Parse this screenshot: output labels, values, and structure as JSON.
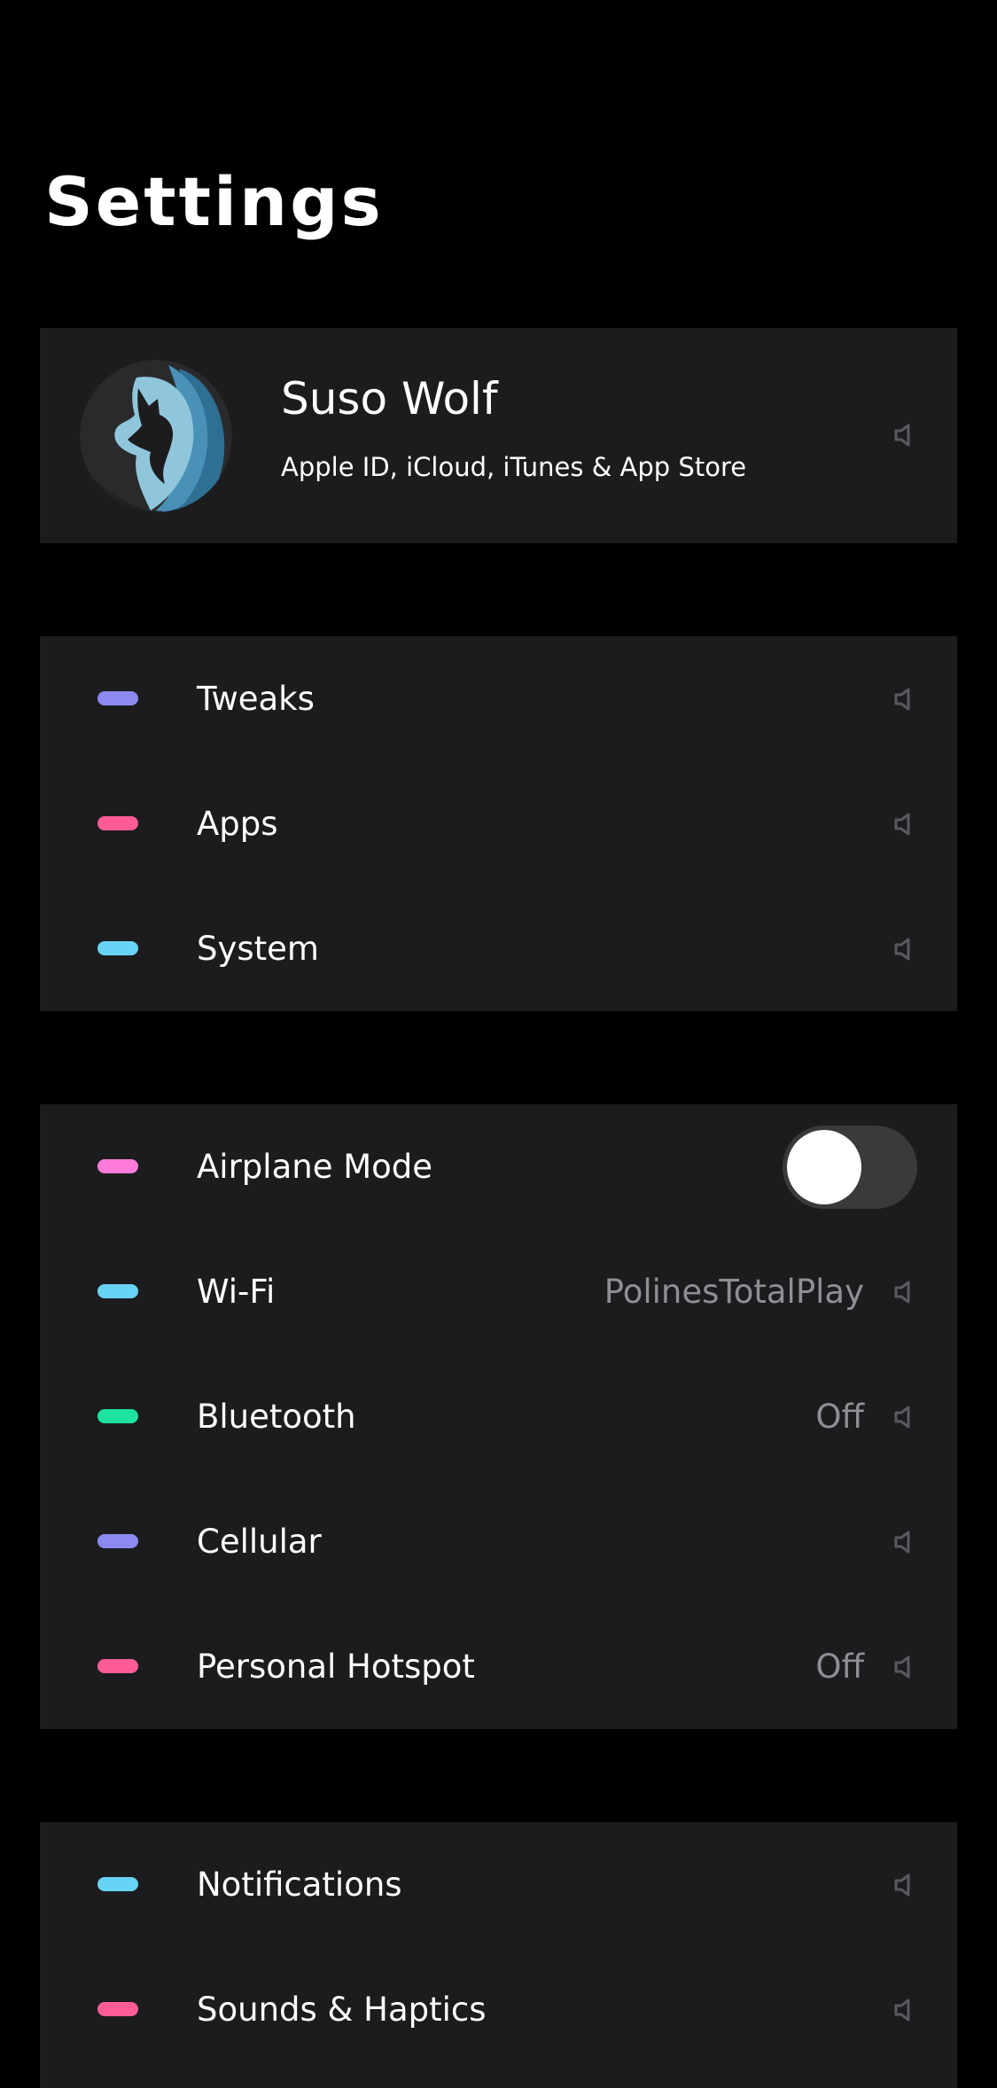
{
  "header": {
    "title": "Settings"
  },
  "profile": {
    "name": "Suso Wolf",
    "subtitle": "Apple ID, iCloud, iTunes & App Store"
  },
  "group1": [
    {
      "label": "Tweaks",
      "color": "#8b8af0"
    },
    {
      "label": "Apps",
      "color": "#ff5c97"
    },
    {
      "label": "System",
      "color": "#67d3f5"
    }
  ],
  "group2": [
    {
      "label": "Airplane Mode",
      "color": "#ff7ad9",
      "toggle": false
    },
    {
      "label": "Wi-Fi",
      "color": "#67d3f5",
      "value": "PolinesTotalPlay"
    },
    {
      "label": "Bluetooth",
      "color": "#1ee3a0",
      "value": "Off"
    },
    {
      "label": "Cellular",
      "color": "#8b8af0"
    },
    {
      "label": "Personal Hotspot",
      "color": "#ff5c97",
      "value": "Off"
    }
  ],
  "group3": [
    {
      "label": "Notifications",
      "color": "#67d3f5"
    },
    {
      "label": "Sounds & Haptics",
      "color": "#ff5c97"
    }
  ],
  "icons": {
    "chevron": "chevron-right-icon",
    "avatar": "wolf-avatar"
  }
}
